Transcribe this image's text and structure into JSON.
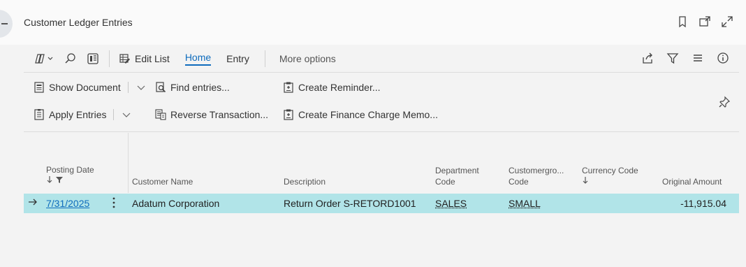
{
  "page": {
    "title": "Customer Ledger Entries"
  },
  "actionbar": {
    "edit_list": "Edit List",
    "home": "Home",
    "entry": "Entry",
    "more_options": "More options"
  },
  "ribbon": {
    "show_document": "Show Document",
    "apply_entries": "Apply Entries",
    "find_entries": "Find entries...",
    "reverse_transaction": "Reverse Transaction...",
    "create_reminder": "Create Reminder...",
    "create_finance_charge_memo": "Create Finance Charge Memo..."
  },
  "grid": {
    "headers": {
      "posting_date": "Posting Date",
      "customer_name": "Customer Name",
      "description": "Description",
      "department_code_1": "Department",
      "department_code_2": "Code",
      "customergroup_code_1": "Customergro...",
      "customergroup_code_2": "Code",
      "currency_code": "Currency Code",
      "original_amount": "Original Amount"
    },
    "rows": [
      {
        "posting_date": "7/31/2025",
        "customer_name": "Adatum Corporation",
        "description": "Return Order S-RETORD1001",
        "department_code": "SALES",
        "customergroup_code": "SMALL",
        "currency_code": "",
        "original_amount": "-11,915.04"
      }
    ]
  },
  "icons": {
    "back": "back-icon",
    "bookmark": "bookmark-icon",
    "open_new_window": "open-in-new-window-icon",
    "expand": "expand-icon",
    "filter": "filter-icon",
    "share": "share-icon",
    "list_view": "list-view-icon",
    "info": "info-icon",
    "pin": "pin-icon"
  },
  "colors": {
    "accent": "#0f6cbd",
    "selected_row": "#b1e4e8"
  }
}
